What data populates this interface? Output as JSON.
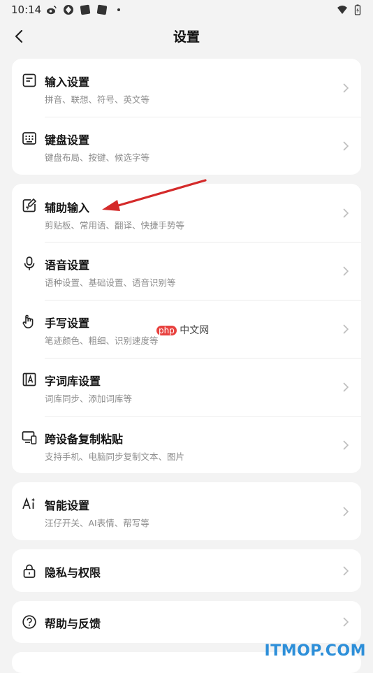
{
  "status_bar": {
    "time": "10:14"
  },
  "header": {
    "title": "设置"
  },
  "groups": [
    {
      "items": [
        {
          "title": "输入设置",
          "subtitle": "拼音、联想、符号、英文等",
          "icon": "document-icon"
        },
        {
          "title": "键盘设置",
          "subtitle": "键盘布局、按键、候选字等",
          "icon": "keyboard-icon"
        }
      ]
    },
    {
      "items": [
        {
          "title": "辅助输入",
          "subtitle": "剪贴板、常用语、翻译、快捷手势等",
          "icon": "edit-lightning-icon"
        },
        {
          "title": "语音设置",
          "subtitle": "语种设置、基础设置、语音识别等",
          "icon": "microphone-icon"
        },
        {
          "title": "手写设置",
          "subtitle": "笔迹颜色、粗细、识别速度等",
          "icon": "hand-icon"
        },
        {
          "title": "字词库设置",
          "subtitle": "词库同步、添加词库等",
          "icon": "dictionary-icon"
        },
        {
          "title": "跨设备复制粘贴",
          "subtitle": "支持手机、电脑同步复制文本、图片",
          "icon": "devices-icon"
        }
      ]
    },
    {
      "items": [
        {
          "title": "智能设置",
          "subtitle": "汪仔开关、AI表情、帮写等",
          "icon": "ai-icon"
        }
      ]
    },
    {
      "items": [
        {
          "title": "隐私与权限",
          "icon": "lock-icon"
        }
      ]
    },
    {
      "items": [
        {
          "title": "帮助与反馈",
          "icon": "help-icon"
        }
      ]
    }
  ],
  "watermarks": {
    "php_badge": "php",
    "php_text": "中文网",
    "site": "ITMOP.COM"
  },
  "colors": {
    "background": "#f3f3f3",
    "card": "#ffffff",
    "arrow": "#d42a2a",
    "site_watermark": "#2d8fd9"
  }
}
